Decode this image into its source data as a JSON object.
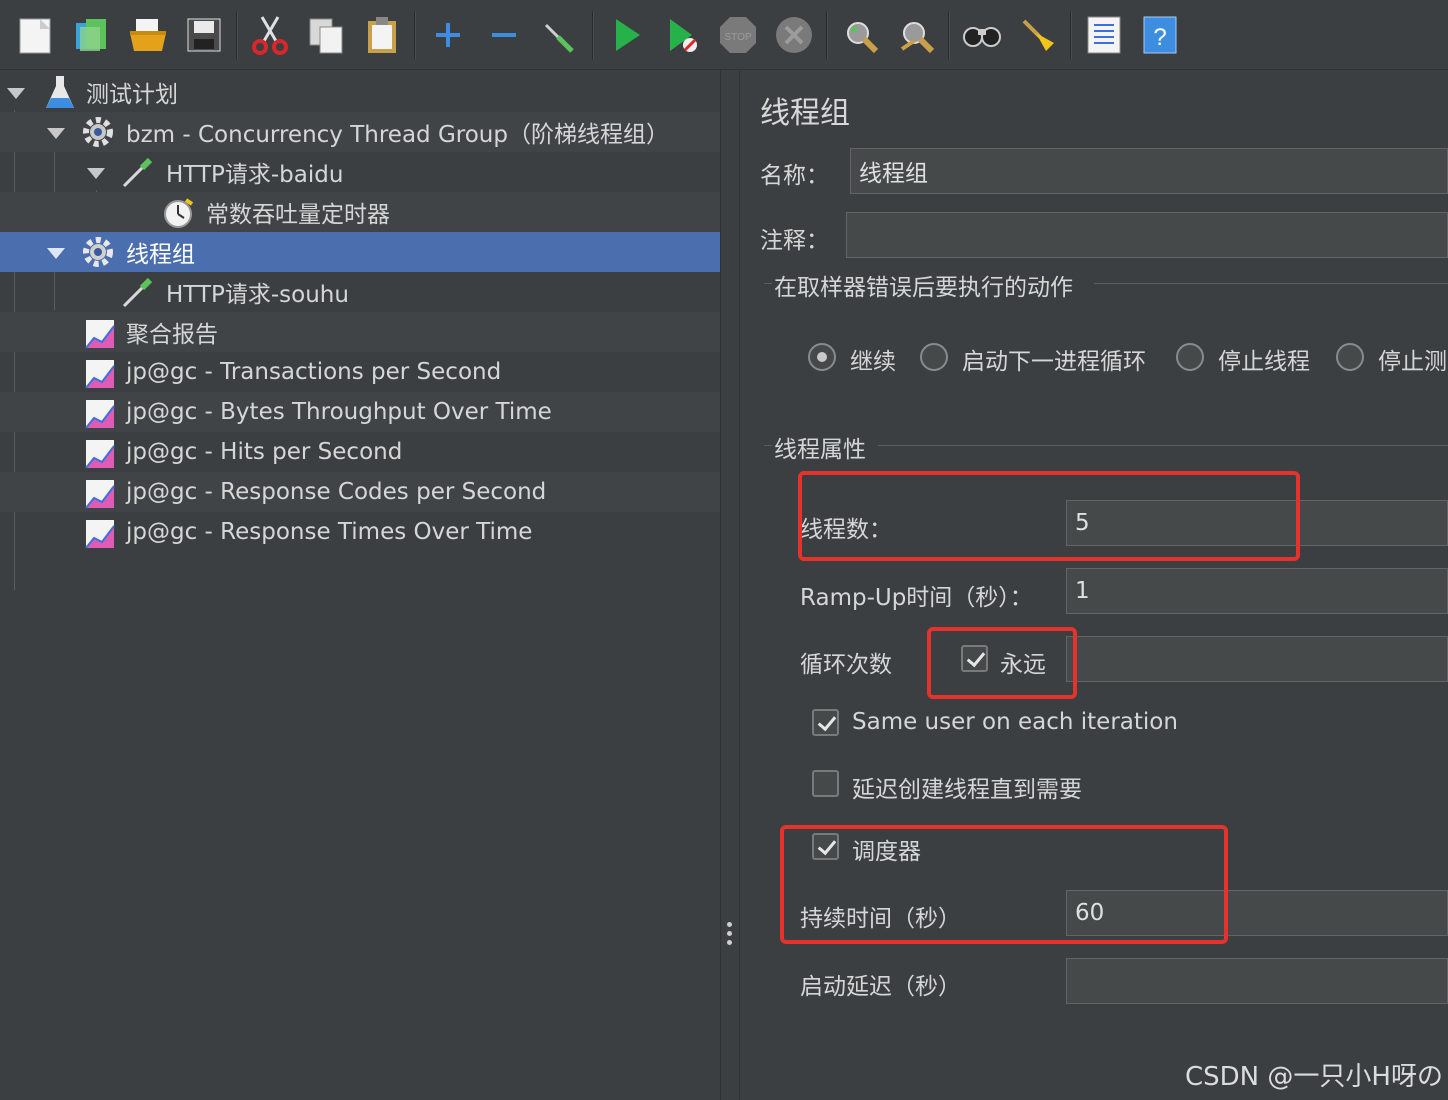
{
  "toolbar": {
    "icons": [
      "new-icon",
      "templates-icon",
      "open-icon",
      "save-icon",
      "cut-icon",
      "copy-icon",
      "paste-icon",
      "expand-icon",
      "collapse-icon",
      "toggle-icon",
      "start-icon",
      "start-no-pause-icon",
      "stop-icon",
      "shutdown-icon",
      "clear-icon",
      "clear-all-icon",
      "search-icon",
      "reset-search-icon",
      "function-helper-icon",
      "help-icon"
    ]
  },
  "tree": {
    "items": [
      {
        "label": "测试计划",
        "icon": "test-plan-icon"
      },
      {
        "label": "bzm - Concurrency Thread Group（阶梯线程组）",
        "icon": "gear-icon"
      },
      {
        "label": "HTTP请求-baidu",
        "icon": "pipette-icon"
      },
      {
        "label": "常数吞吐量定时器",
        "icon": "timer-icon"
      },
      {
        "label": "线程组",
        "icon": "gear-icon"
      },
      {
        "label": "HTTP请求-souhu",
        "icon": "pipette-icon"
      },
      {
        "label": "聚合报告",
        "icon": "graph-icon"
      },
      {
        "label": "jp@gc - Transactions per Second",
        "icon": "graph-icon"
      },
      {
        "label": "jp@gc - Bytes Throughput Over Time",
        "icon": "graph-icon"
      },
      {
        "label": "jp@gc - Hits per Second",
        "icon": "graph-icon"
      },
      {
        "label": "jp@gc - Response Codes per Second",
        "icon": "graph-icon"
      },
      {
        "label": "jp@gc - Response Times Over Time",
        "icon": "graph-icon"
      }
    ]
  },
  "panel": {
    "title": "线程组",
    "name_label": "名称：",
    "name_value": "线程组",
    "comment_label": "注释：",
    "comment_value": "",
    "error_group_title": "在取样器错误后要执行的动作",
    "error_actions": [
      "继续",
      "启动下一进程循环",
      "停止线程",
      "停止测"
    ],
    "error_selected": "继续",
    "props_title": "线程属性",
    "threads_label": "线程数：",
    "threads_value": "5",
    "rampup_label": "Ramp-Up时间（秒）：",
    "rampup_value": "1",
    "loop_label": "循环次数",
    "forever_label": "永远",
    "forever_checked": true,
    "loop_value": "",
    "same_user_label": "Same user on each iteration",
    "same_user_checked": true,
    "delay_label": "延迟创建线程直到需要",
    "delay_checked": false,
    "scheduler_label": "调度器",
    "scheduler_checked": true,
    "duration_label": "持续时间（秒）",
    "duration_value": "60",
    "startup_delay_label": "启动延迟（秒）",
    "startup_delay_value": ""
  },
  "watermark": "CSDN @一只小H呀の",
  "colors": {
    "highlight": "#e5322d",
    "selection": "#4b6eaf",
    "background": "#3c3f41"
  }
}
